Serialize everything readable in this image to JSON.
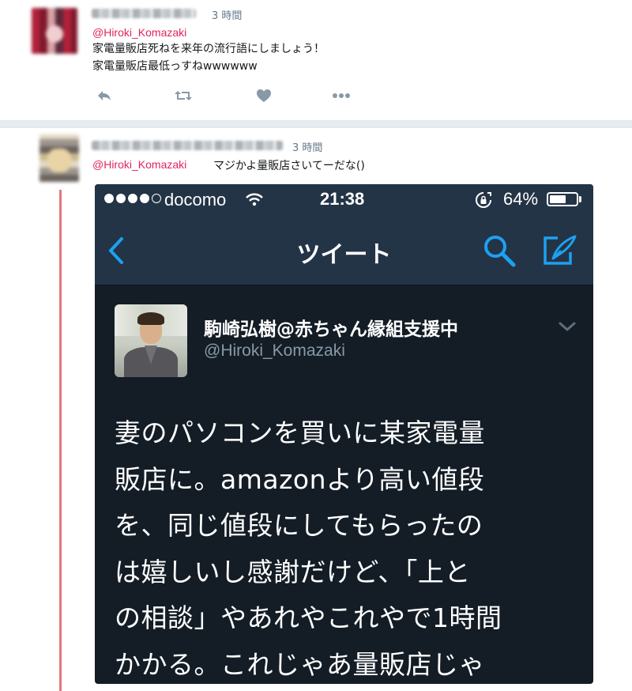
{
  "tweet1": {
    "time": "3 時間",
    "mention": "@Hiroki_Komazaki",
    "lines": [
      "家電量販店死ねを来年の流行語にしましょう！",
      "家電量販店最低っすねwwwwww"
    ]
  },
  "tweet2": {
    "time": "3 時間",
    "mention": "@Hiroki_Komazaki",
    "text": "マジかよ量販店さいてーだな()"
  },
  "screenshot": {
    "status_bar": {
      "carrier": "docomo",
      "time": "21:38",
      "battery": "64%",
      "battery_level": 0.64
    },
    "nav": {
      "title": "ツイート"
    },
    "tweet": {
      "display_name": "駒崎弘樹@赤ちゃん縁組支援中",
      "handle": "@Hiroki_Komazaki",
      "lines": [
        "妻のパソコンを買いに某家電量",
        "販店に。amazonより高い値段",
        "を、同じ値段にしてもらったの",
        "は嬉しいし感謝だけど、「上と",
        "の相談」やあれやこれやで1時間",
        "かかる。これじゃあ量販店じゃ"
      ]
    }
  },
  "colors": {
    "mention": "#e0245e",
    "thread_line": "#e8767c",
    "phone_bg": "#141d26",
    "phone_bar": "#243447",
    "accent_blue": "#1da1f2"
  },
  "icons": [
    "reply-icon",
    "retweet-icon",
    "like-icon",
    "more-icon",
    "wifi-icon",
    "rotation-lock-icon",
    "back-icon",
    "search-icon",
    "compose-icon",
    "chevron-down-icon"
  ]
}
